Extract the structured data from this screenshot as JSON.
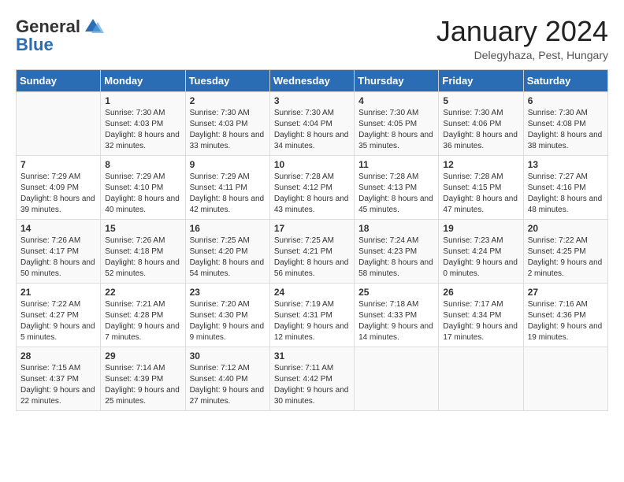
{
  "logo": {
    "general": "General",
    "blue": "Blue"
  },
  "title": "January 2024",
  "location": "Delegyhaza, Pest, Hungary",
  "days_of_week": [
    "Sunday",
    "Monday",
    "Tuesday",
    "Wednesday",
    "Thursday",
    "Friday",
    "Saturday"
  ],
  "weeks": [
    [
      {
        "day": "",
        "sunrise": "",
        "sunset": "",
        "daylight": ""
      },
      {
        "day": "1",
        "sunrise": "Sunrise: 7:30 AM",
        "sunset": "Sunset: 4:03 PM",
        "daylight": "Daylight: 8 hours and 32 minutes."
      },
      {
        "day": "2",
        "sunrise": "Sunrise: 7:30 AM",
        "sunset": "Sunset: 4:03 PM",
        "daylight": "Daylight: 8 hours and 33 minutes."
      },
      {
        "day": "3",
        "sunrise": "Sunrise: 7:30 AM",
        "sunset": "Sunset: 4:04 PM",
        "daylight": "Daylight: 8 hours and 34 minutes."
      },
      {
        "day": "4",
        "sunrise": "Sunrise: 7:30 AM",
        "sunset": "Sunset: 4:05 PM",
        "daylight": "Daylight: 8 hours and 35 minutes."
      },
      {
        "day": "5",
        "sunrise": "Sunrise: 7:30 AM",
        "sunset": "Sunset: 4:06 PM",
        "daylight": "Daylight: 8 hours and 36 minutes."
      },
      {
        "day": "6",
        "sunrise": "Sunrise: 7:30 AM",
        "sunset": "Sunset: 4:08 PM",
        "daylight": "Daylight: 8 hours and 38 minutes."
      }
    ],
    [
      {
        "day": "7",
        "sunrise": "Sunrise: 7:29 AM",
        "sunset": "Sunset: 4:09 PM",
        "daylight": "Daylight: 8 hours and 39 minutes."
      },
      {
        "day": "8",
        "sunrise": "Sunrise: 7:29 AM",
        "sunset": "Sunset: 4:10 PM",
        "daylight": "Daylight: 8 hours and 40 minutes."
      },
      {
        "day": "9",
        "sunrise": "Sunrise: 7:29 AM",
        "sunset": "Sunset: 4:11 PM",
        "daylight": "Daylight: 8 hours and 42 minutes."
      },
      {
        "day": "10",
        "sunrise": "Sunrise: 7:28 AM",
        "sunset": "Sunset: 4:12 PM",
        "daylight": "Daylight: 8 hours and 43 minutes."
      },
      {
        "day": "11",
        "sunrise": "Sunrise: 7:28 AM",
        "sunset": "Sunset: 4:13 PM",
        "daylight": "Daylight: 8 hours and 45 minutes."
      },
      {
        "day": "12",
        "sunrise": "Sunrise: 7:28 AM",
        "sunset": "Sunset: 4:15 PM",
        "daylight": "Daylight: 8 hours and 47 minutes."
      },
      {
        "day": "13",
        "sunrise": "Sunrise: 7:27 AM",
        "sunset": "Sunset: 4:16 PM",
        "daylight": "Daylight: 8 hours and 48 minutes."
      }
    ],
    [
      {
        "day": "14",
        "sunrise": "Sunrise: 7:26 AM",
        "sunset": "Sunset: 4:17 PM",
        "daylight": "Daylight: 8 hours and 50 minutes."
      },
      {
        "day": "15",
        "sunrise": "Sunrise: 7:26 AM",
        "sunset": "Sunset: 4:18 PM",
        "daylight": "Daylight: 8 hours and 52 minutes."
      },
      {
        "day": "16",
        "sunrise": "Sunrise: 7:25 AM",
        "sunset": "Sunset: 4:20 PM",
        "daylight": "Daylight: 8 hours and 54 minutes."
      },
      {
        "day": "17",
        "sunrise": "Sunrise: 7:25 AM",
        "sunset": "Sunset: 4:21 PM",
        "daylight": "Daylight: 8 hours and 56 minutes."
      },
      {
        "day": "18",
        "sunrise": "Sunrise: 7:24 AM",
        "sunset": "Sunset: 4:23 PM",
        "daylight": "Daylight: 8 hours and 58 minutes."
      },
      {
        "day": "19",
        "sunrise": "Sunrise: 7:23 AM",
        "sunset": "Sunset: 4:24 PM",
        "daylight": "Daylight: 9 hours and 0 minutes."
      },
      {
        "day": "20",
        "sunrise": "Sunrise: 7:22 AM",
        "sunset": "Sunset: 4:25 PM",
        "daylight": "Daylight: 9 hours and 2 minutes."
      }
    ],
    [
      {
        "day": "21",
        "sunrise": "Sunrise: 7:22 AM",
        "sunset": "Sunset: 4:27 PM",
        "daylight": "Daylight: 9 hours and 5 minutes."
      },
      {
        "day": "22",
        "sunrise": "Sunrise: 7:21 AM",
        "sunset": "Sunset: 4:28 PM",
        "daylight": "Daylight: 9 hours and 7 minutes."
      },
      {
        "day": "23",
        "sunrise": "Sunrise: 7:20 AM",
        "sunset": "Sunset: 4:30 PM",
        "daylight": "Daylight: 9 hours and 9 minutes."
      },
      {
        "day": "24",
        "sunrise": "Sunrise: 7:19 AM",
        "sunset": "Sunset: 4:31 PM",
        "daylight": "Daylight: 9 hours and 12 minutes."
      },
      {
        "day": "25",
        "sunrise": "Sunrise: 7:18 AM",
        "sunset": "Sunset: 4:33 PM",
        "daylight": "Daylight: 9 hours and 14 minutes."
      },
      {
        "day": "26",
        "sunrise": "Sunrise: 7:17 AM",
        "sunset": "Sunset: 4:34 PM",
        "daylight": "Daylight: 9 hours and 17 minutes."
      },
      {
        "day": "27",
        "sunrise": "Sunrise: 7:16 AM",
        "sunset": "Sunset: 4:36 PM",
        "daylight": "Daylight: 9 hours and 19 minutes."
      }
    ],
    [
      {
        "day": "28",
        "sunrise": "Sunrise: 7:15 AM",
        "sunset": "Sunset: 4:37 PM",
        "daylight": "Daylight: 9 hours and 22 minutes."
      },
      {
        "day": "29",
        "sunrise": "Sunrise: 7:14 AM",
        "sunset": "Sunset: 4:39 PM",
        "daylight": "Daylight: 9 hours and 25 minutes."
      },
      {
        "day": "30",
        "sunrise": "Sunrise: 7:12 AM",
        "sunset": "Sunset: 4:40 PM",
        "daylight": "Daylight: 9 hours and 27 minutes."
      },
      {
        "day": "31",
        "sunrise": "Sunrise: 7:11 AM",
        "sunset": "Sunset: 4:42 PM",
        "daylight": "Daylight: 9 hours and 30 minutes."
      },
      {
        "day": "",
        "sunrise": "",
        "sunset": "",
        "daylight": ""
      },
      {
        "day": "",
        "sunrise": "",
        "sunset": "",
        "daylight": ""
      },
      {
        "day": "",
        "sunrise": "",
        "sunset": "",
        "daylight": ""
      }
    ]
  ]
}
